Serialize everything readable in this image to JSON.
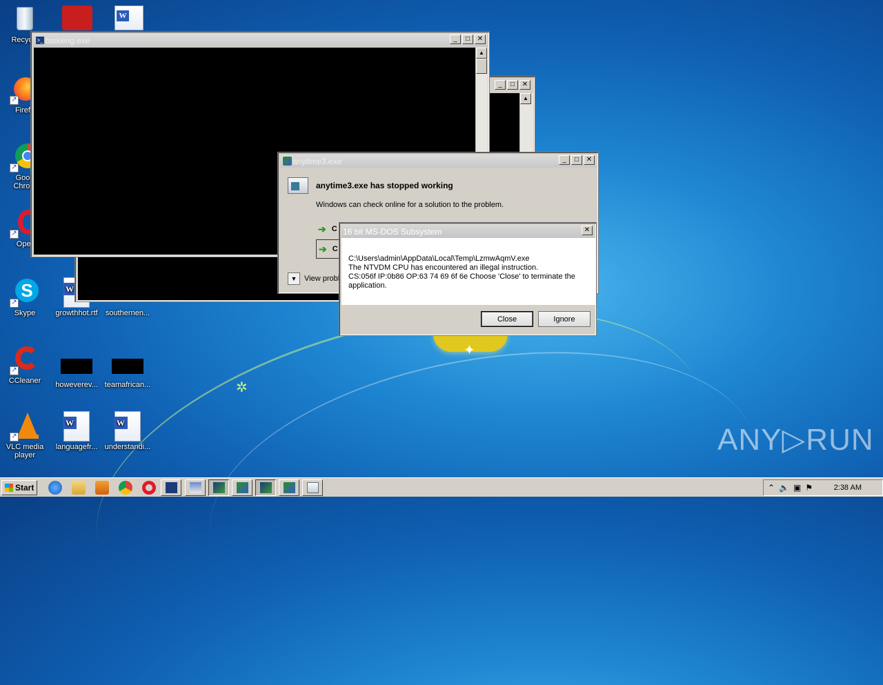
{
  "desktop_icons": [
    {
      "label": "Recycle",
      "icon": "recycle-bin-icon"
    },
    {
      "label": "Firefo",
      "icon": "firefox-icon"
    },
    {
      "label": "Goog Chrom",
      "icon": "chrome-icon"
    },
    {
      "label": "Oper",
      "icon": "opera-icon"
    },
    {
      "label": "Skype",
      "icon": "skype-icon"
    },
    {
      "label": "growthhot.rtf",
      "icon": "word-document-icon"
    },
    {
      "label": "southernen...",
      "icon": "file-icon"
    },
    {
      "label": "CCleaner",
      "icon": "ccleaner-icon"
    },
    {
      "label": "howeverev...",
      "icon": "file-icon"
    },
    {
      "label": "teamafrican...",
      "icon": "file-icon"
    },
    {
      "label": "VLC media player",
      "icon": "vlc-icon"
    },
    {
      "label": "languagefr...",
      "icon": "word-document-icon"
    },
    {
      "label": "understandi...",
      "icon": "word-document-icon"
    }
  ],
  "windows": {
    "taskeng": {
      "title": "taskeng.exe"
    },
    "crash": {
      "title": "anytime3.exe",
      "heading": "anytime3.exe has stopped working",
      "subtext": "Windows can check online for a solution to the problem.",
      "option1_prefix": "C",
      "option2_prefix": "C",
      "details_label": "View probl"
    },
    "ntvdm": {
      "title": "16 bit MS-DOS Subsystem",
      "line1": "C:\\Users\\admin\\AppData\\Local\\Temp\\LzmwAqmV.exe",
      "line2": "The NTVDM CPU has encountered an illegal instruction.",
      "line3": "CS:056f IP:0b86 OP:63 74 69 6f 6e Choose 'Close' to terminate the",
      "line4": "application.",
      "close_label": "Close",
      "ignore_label": "Ignore"
    }
  },
  "taskbar": {
    "start_label": "Start",
    "clock": "2:38 AM"
  },
  "watermark": "ANY▷RUN"
}
